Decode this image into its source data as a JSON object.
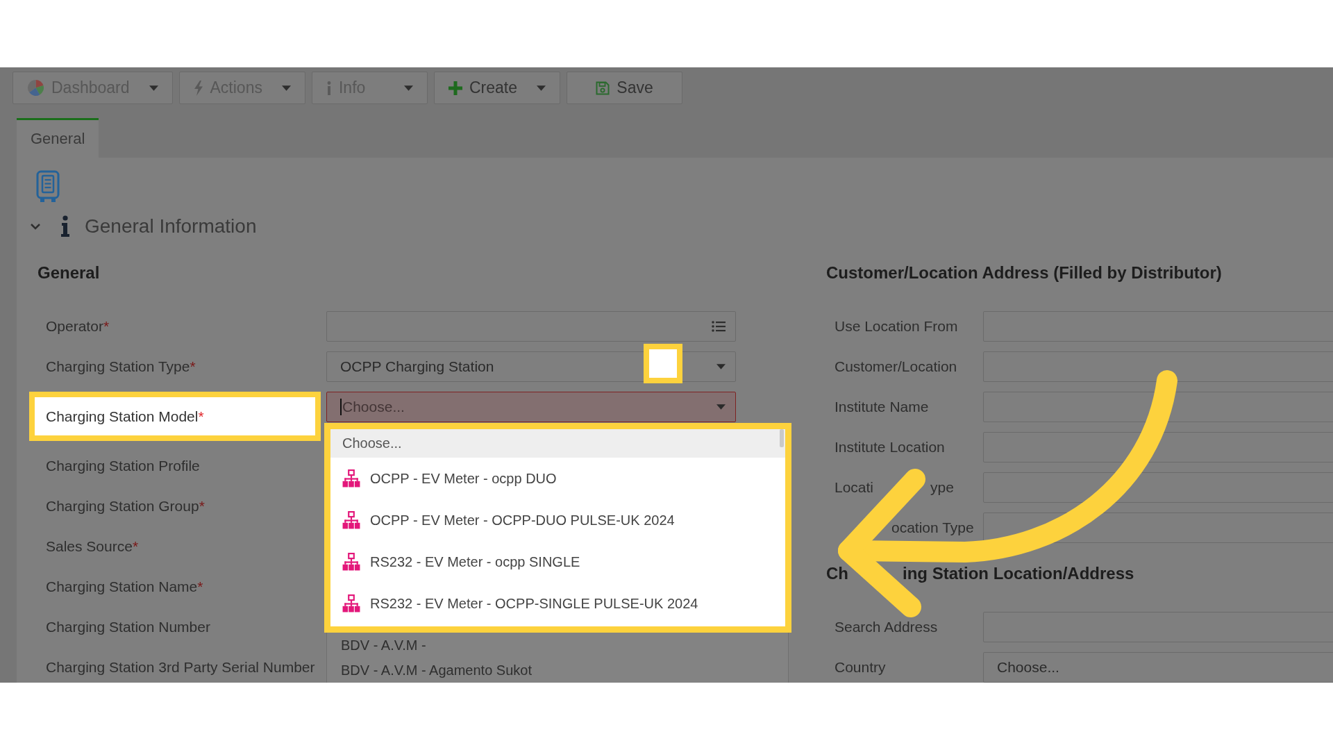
{
  "toolbar": {
    "buttons": [
      {
        "label": "Dashboard",
        "dropdown": true,
        "disabled": true
      },
      {
        "label": "Actions",
        "dropdown": true,
        "disabled": true
      },
      {
        "label": "Info",
        "dropdown": true,
        "disabled": true
      },
      {
        "label": "Create",
        "dropdown": true,
        "disabled": false
      },
      {
        "label": "Save",
        "dropdown": false,
        "disabled": false
      }
    ]
  },
  "tabs": [
    {
      "label": "General",
      "selected": true
    }
  ],
  "section": {
    "title": "General Information",
    "expanded": true
  },
  "left_group": {
    "title": "General",
    "fields": [
      {
        "label": "Operator",
        "required_mark": "*",
        "highlighted": false,
        "marker": false,
        "control": {
          "kind": "lookup",
          "invalid": false,
          "focused": false
        }
      },
      {
        "label": "Charging Station Type",
        "required_mark": "*",
        "highlighted": false,
        "marker": true,
        "control": {
          "kind": "select",
          "value": "OCPP Charging Station",
          "invalid": false,
          "focused": false
        }
      },
      {
        "label": "Charging Station Model",
        "required_mark": "*",
        "highlighted": true,
        "marker": false,
        "control": {
          "kind": "select",
          "placeholder": "Choose...",
          "invalid": true,
          "focused": true,
          "options": [
            {
              "label": "Choose...",
              "kind": "text",
              "selected": true,
              "highlighted": true
            },
            {
              "label": "OCPP - EV Meter - ocpp DUO",
              "kind": "model",
              "selected": false,
              "highlighted": true
            },
            {
              "label": "OCPP - EV Meter - OCPP-DUO PULSE-UK 2024",
              "kind": "model",
              "selected": false,
              "highlighted": true
            },
            {
              "label": "RS232 - EV Meter - ocpp SINGLE",
              "kind": "model",
              "selected": false,
              "highlighted": true
            },
            {
              "label": "RS232 - EV Meter - OCPP-SINGLE PULSE-UK 2024",
              "kind": "model",
              "selected": false,
              "highlighted": true
            },
            {
              "label": "BDV - A.V.M -",
              "kind": "text",
              "selected": false,
              "highlighted": false
            },
            {
              "label": "BDV - A.V.M - Agamento Sukot",
              "kind": "text",
              "selected": false,
              "highlighted": false
            }
          ]
        }
      },
      {
        "label": "Charging Station Profile",
        "highlighted": false,
        "marker": false
      },
      {
        "label": "Charging Station Group",
        "required_mark": "*",
        "highlighted": false,
        "marker": false
      },
      {
        "label": "Sales Source",
        "required_mark": "*",
        "highlighted": false,
        "marker": false
      },
      {
        "label": "Charging Station Name",
        "required_mark": "*",
        "highlighted": false,
        "marker": false
      },
      {
        "label": "Charging Station Number",
        "highlighted": false,
        "marker": false
      },
      {
        "label": "Charging Station 3rd Party Serial Number",
        "highlighted": false,
        "marker": false
      }
    ]
  },
  "right_groups": [
    {
      "title_parts": [
        {
          "text": "Customer/Location Address (Filled by Distributor)",
          "hidden_before": false
        }
      ],
      "fields": [
        {
          "label_parts": [
            {
              "text": "Use Location From",
              "hidden_before": false
            }
          ]
        },
        {
          "label_parts": [
            {
              "text": "Customer/Location",
              "hidden_before": false
            }
          ]
        },
        {
          "label_parts": [
            {
              "text": "Institute Name",
              "hidden_before": false
            }
          ]
        },
        {
          "label_parts": [
            {
              "text": "Institute Location",
              "hidden_before": false
            }
          ]
        },
        {
          "label_parts": [
            {
              "text": "Locati",
              "hidden_before": false
            },
            {
              "text": "ype",
              "hidden_before": true
            }
          ]
        },
        {
          "label_parts": [
            {
              "text": "ocation Type",
              "hidden_before": true
            }
          ]
        }
      ]
    },
    {
      "title_parts": [
        {
          "text": "Ch",
          "hidden_before": false
        },
        {
          "text": "ing Station Location/Address",
          "hidden_before": true
        }
      ],
      "fields": [
        {
          "label_parts": [
            {
              "text": "Search Address",
              "hidden_before": false
            }
          ]
        },
        {
          "label_parts": [
            {
              "text": "Country",
              "hidden_before": false
            }
          ],
          "value": "Choose..."
        }
      ]
    }
  ],
  "annotation": {
    "arrow": true
  }
}
